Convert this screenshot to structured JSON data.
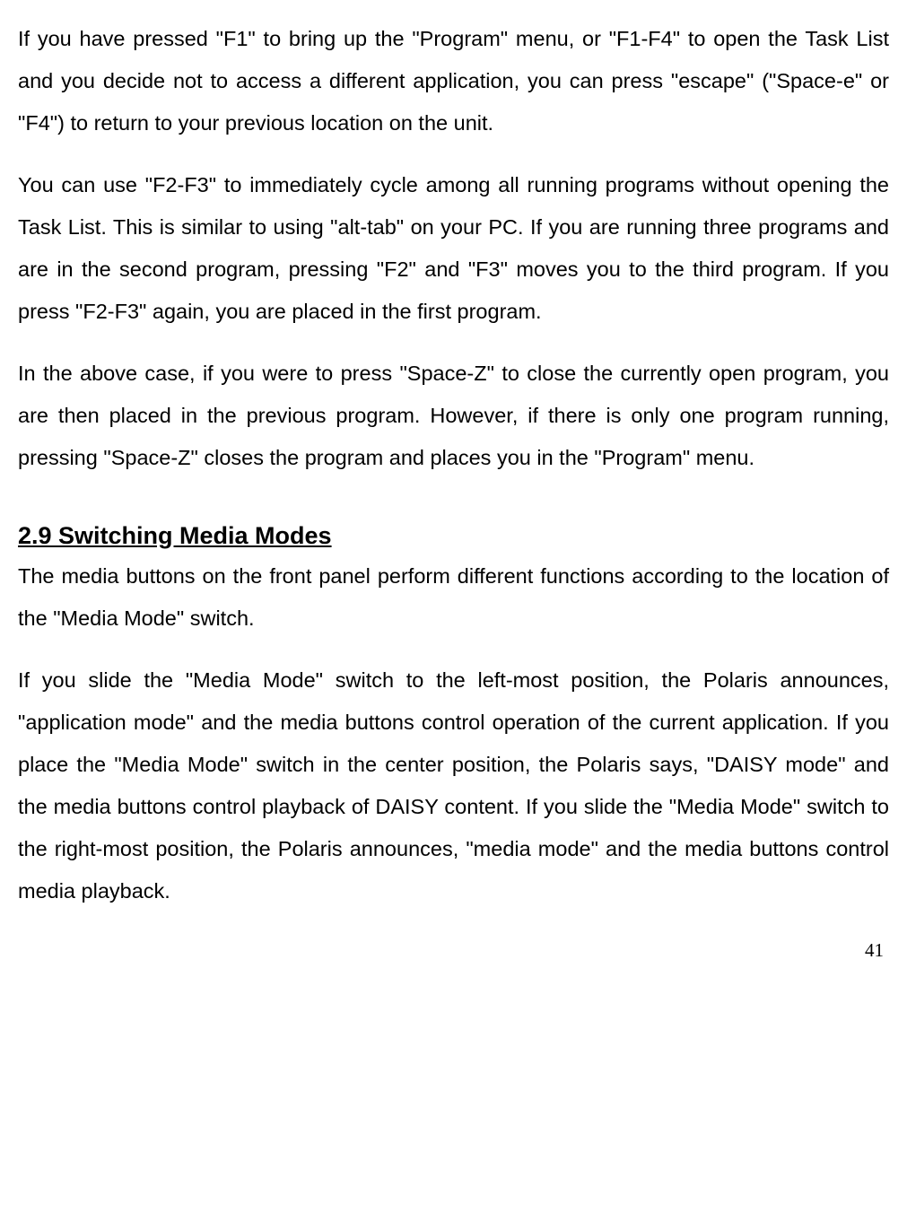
{
  "paragraphs": {
    "p1": "If you have pressed \"F1\" to bring up the \"Program\" menu, or \"F1-F4\" to open the Task List and you decide not to access a different application, you can press \"escape\" (\"Space-e\" or \"F4\") to return to your previous location on the unit.",
    "p2": "You can use \"F2-F3\" to immediately cycle among all running programs without opening the Task List. This is similar to using \"alt-tab\" on your PC. If you are running three programs and are in the second program, pressing \"F2\" and \"F3\" moves you to the third program. If you press \"F2-F3\" again, you are placed in the first program.",
    "p3": "In the above case, if you were to press \"Space-Z\" to close the currently open program, you are then placed in the previous program. However, if there is only one program running, pressing \"Space-Z\" closes the program and places you in the \"Program\" menu.",
    "p4": "The media buttons on the front panel perform different functions according to the location of the \"Media Mode\" switch.",
    "p5": "If you slide the \"Media Mode\" switch to the left-most position, the Polaris announces, \"application mode\" and the media buttons control operation of the current application. If you place the \"Media Mode\" switch in the center position, the Polaris says, \"DAISY mode\" and the media buttons control playback of DAISY content. If you slide the \"Media Mode\" switch to the right-most position, the Polaris announces, \"media mode\" and the media buttons control media playback."
  },
  "heading": "2.9 Switching Media Modes",
  "page_number": "41"
}
